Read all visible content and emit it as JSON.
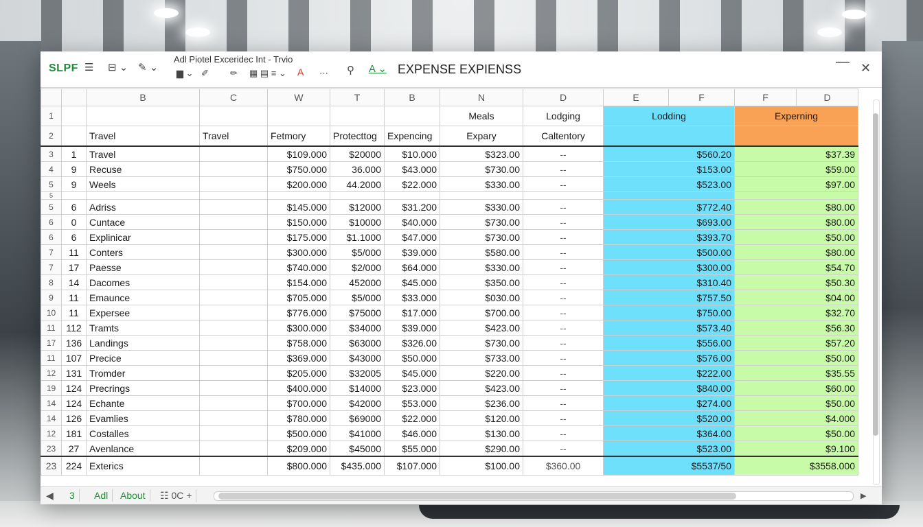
{
  "window": {
    "app_logo": "SLPF",
    "doc_title": "Adl Piotel Exceridec Int - Trvio",
    "sheet_title": "EXPENSE EXPIENSS",
    "minimize": "—",
    "close": "✕"
  },
  "colors": {
    "blue": "#6fe0fb",
    "green": "#c8fba7",
    "orange": "#f9a155",
    "logo": "#1f8f3a"
  },
  "columns": [
    "",
    "",
    "B",
    "C",
    "W",
    "T",
    "B",
    "N",
    "D",
    "E",
    "F",
    "F",
    "D"
  ],
  "header_row1": {
    "rownum": "1",
    "meals": "Meals",
    "lodging": "Lodging",
    "lodding": "Lodding",
    "experning": "Experning"
  },
  "header_row2": {
    "rownum": "2",
    "b": "Travel",
    "c": "Travel",
    "w": "Fetmory",
    "t": "Protecttog",
    "b2": "Expencing",
    "n": "Expary",
    "d": "Caltentory"
  },
  "rows_top": [
    {
      "r": "3",
      "id": "1",
      "name": "Travel",
      "w": "$109.000",
      "t": "$20000",
      "b": "$10.000",
      "n": "$323.00",
      "d": "--",
      "e": "$560.20",
      "f": "$37.39"
    },
    {
      "r": "4",
      "id": "9",
      "name": "Recuse",
      "w": "$750.000",
      "t": "36.000",
      "b": "$43.000",
      "n": "$730.00",
      "d": "--",
      "e": "$153.00",
      "f": "$59.00"
    },
    {
      "r": "5",
      "id": "9",
      "name": "Weels",
      "w": "$200.000",
      "t": "44.2000",
      "b": "$22.000",
      "n": "$330.00",
      "d": "--",
      "e": "$523.00",
      "f": "$97.00"
    }
  ],
  "spacer_row": "5",
  "rows_main": [
    {
      "r": "5",
      "id": "6",
      "name": "Adriss",
      "w": "$145.000",
      "t": "$12000",
      "b": "$31.200",
      "n": "$330.00",
      "d": "--",
      "e": "$772.40",
      "f": "$80.00"
    },
    {
      "r": "6",
      "id": "0",
      "name": "Cuntace",
      "w": "$150.000",
      "t": "$10000",
      "b": "$40.000",
      "n": "$730.00",
      "d": "--",
      "e": "$693.00",
      "f": "$80.00"
    },
    {
      "r": "6",
      "id": "6",
      "name": "Explinicar",
      "w": "$175.000",
      "t": "$1.1000",
      "b": "$47.000",
      "n": "$730.00",
      "d": "--",
      "e": "$393.70",
      "f": "$50.00"
    },
    {
      "r": "7",
      "id": "11",
      "name": "Conters",
      "w": "$300.000",
      "t": "$5/000",
      "b": "$39.000",
      "n": "$580.00",
      "d": "--",
      "e": "$500.00",
      "f": "$80.00"
    },
    {
      "r": "7",
      "id": "17",
      "name": "Paesse",
      "w": "$740.000",
      "t": "$2/000",
      "b": "$64.000",
      "n": "$330.00",
      "d": "--",
      "e": "$300.00",
      "f": "$54.70"
    },
    {
      "r": "8",
      "id": "14",
      "name": "Dacomes",
      "w": "$154.000",
      "t": "452000",
      "b": "$45.000",
      "n": "$350.00",
      "d": "--",
      "e": "$310.40",
      "f": "$50.30"
    },
    {
      "r": "9",
      "id": "11",
      "name": "Emaunce",
      "w": "$705.000",
      "t": "$5/000",
      "b": "$33.000",
      "n": "$030.00",
      "d": "--",
      "e": "$757.50",
      "f": "$04.00"
    },
    {
      "r": "10",
      "id": "11",
      "name": "Expersee",
      "w": "$776.000",
      "t": "$75000",
      "b": "$17.000",
      "n": "$700.00",
      "d": "--",
      "e": "$750.00",
      "f": "$32.70"
    },
    {
      "r": "11",
      "id": "112",
      "name": "Tramts",
      "w": "$300.000",
      "t": "$34000",
      "b": "$39.000",
      "n": "$423.00",
      "d": "--",
      "e": "$573.40",
      "f": "$56.30"
    },
    {
      "r": "17",
      "id": "136",
      "name": "Landings",
      "w": "$758.000",
      "t": "$63000",
      "b": "$326.00",
      "n": "$730.00",
      "d": "--",
      "e": "$556.00",
      "f": "$57.20"
    },
    {
      "r": "11",
      "id": "107",
      "name": "Precice",
      "w": "$369.000",
      "t": "$43000",
      "b": "$50.000",
      "n": "$733.00",
      "d": "--",
      "e": "$576.00",
      "f": "$50.00"
    },
    {
      "r": "12",
      "id": "131",
      "name": "Tromder",
      "w": "$205.000",
      "t": "$32005",
      "b": "$45.000",
      "n": "$220.00",
      "d": "--",
      "e": "$222.00",
      "f": "$35.55"
    },
    {
      "r": "19",
      "id": "124",
      "name": "Precrings",
      "w": "$400.000",
      "t": "$14000",
      "b": "$23.000",
      "n": "$423.00",
      "d": "--",
      "e": "$840.00",
      "f": "$60.00"
    },
    {
      "r": "14",
      "id": "124",
      "name": "Echante",
      "w": "$700.000",
      "t": "$42000",
      "b": "$53.000",
      "n": "$236.00",
      "d": "--",
      "e": "$274.00",
      "f": "$50.00"
    },
    {
      "r": "14",
      "id": "126",
      "name": "Evamlies",
      "w": "$780.000",
      "t": "$69000",
      "b": "$22.000",
      "n": "$120.00",
      "d": "--",
      "e": "$520.00",
      "f": "$4.000"
    },
    {
      "r": "12",
      "id": "181",
      "name": "Costalles",
      "w": "$500.000",
      "t": "$41000",
      "b": "$46.000",
      "n": "$130.00",
      "d": "--",
      "e": "$364.00",
      "f": "$50.00"
    },
    {
      "r": "23",
      "id": "27",
      "name": "Avenlance",
      "w": "$209.000",
      "t": "$45000",
      "b": "$55.000",
      "n": "$290.00",
      "d": "--",
      "e": "$523.00",
      "f": "$9.100"
    }
  ],
  "total_row": {
    "r": "23",
    "id": "224",
    "name": "Exterics",
    "w": "$800.000",
    "t": "$435.000",
    "b": "$107.000",
    "n": "$100.00",
    "d": "$360.00",
    "e": "$5537/50",
    "f": "$3558.000"
  },
  "tabs": {
    "prev": "◀",
    "t1": "3",
    "t2": "Adl",
    "t3": "About",
    "t4": "☷ 0C +",
    "next": "▶"
  }
}
